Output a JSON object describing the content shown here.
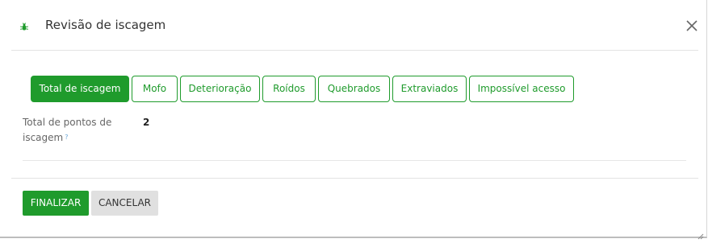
{
  "header": {
    "title": "Revisão de iscagem",
    "icon": "bug-icon",
    "close_icon": "close-icon"
  },
  "tabs": [
    {
      "label": "Total de iscagem",
      "active": true
    },
    {
      "label": "Mofo",
      "active": false
    },
    {
      "label": "Deterioração",
      "active": false
    },
    {
      "label": "Roídos",
      "active": false
    },
    {
      "label": "Quebrados",
      "active": false
    },
    {
      "label": "Extraviados",
      "active": false
    },
    {
      "label": "Impossível acesso",
      "active": false
    }
  ],
  "field": {
    "label": "Total de pontos de iscagem",
    "help": "?",
    "value": "2"
  },
  "footer": {
    "finalizar_label": "FINALIZAR",
    "cancelar_label": "CANCELAR"
  },
  "colors": {
    "accent": "#1f9b2c",
    "secondary_button": "#e0e0e0"
  }
}
